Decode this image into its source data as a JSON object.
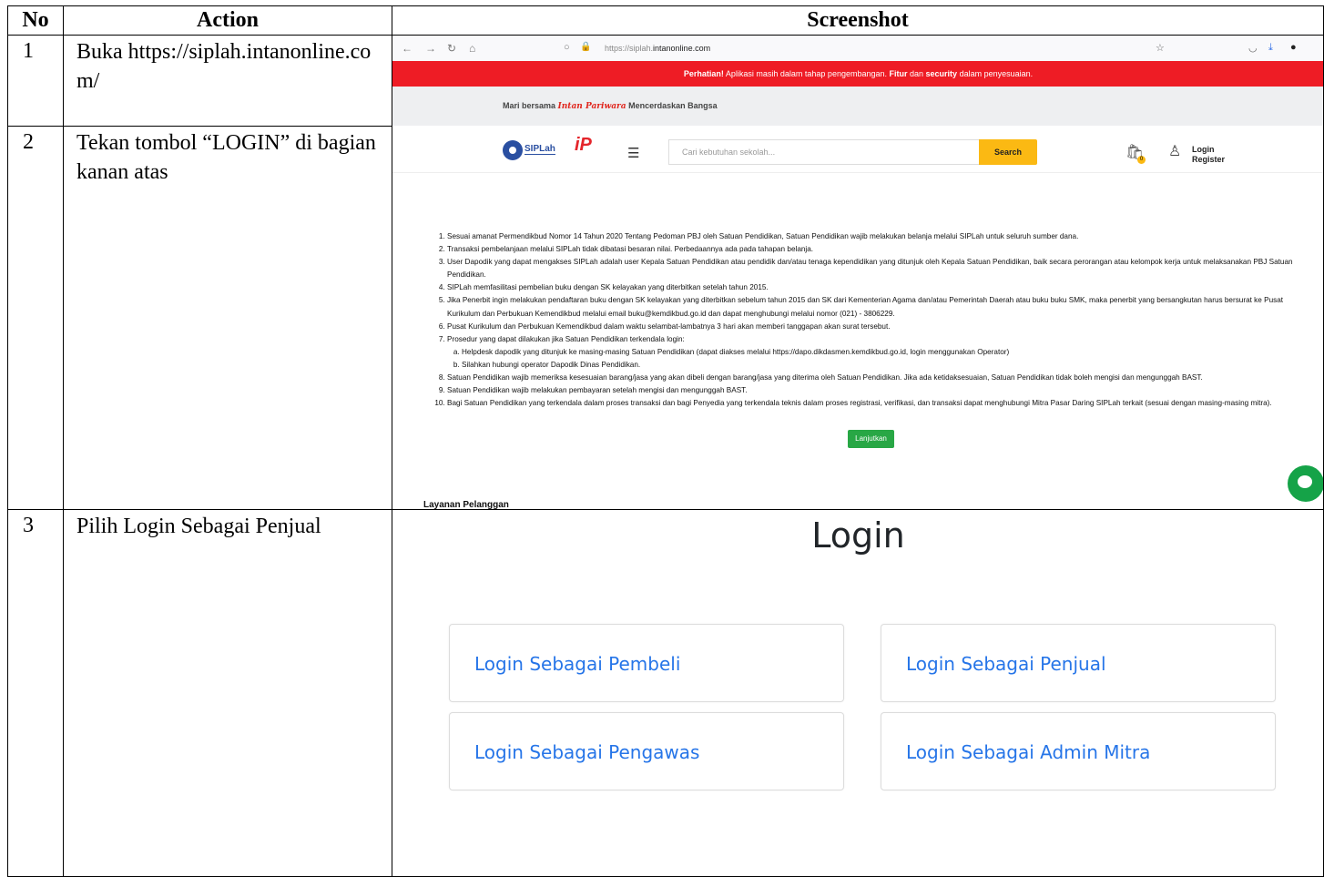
{
  "table": {
    "headers": {
      "no": "No",
      "action": "Action",
      "screenshot": "Screenshot"
    },
    "rows": [
      {
        "no": "1",
        "action": "Buka https://siplah.intanonline.com/"
      },
      {
        "no": "2",
        "action": "Tekan tombol “LOGIN” di bagian kanan atas"
      },
      {
        "no": "3",
        "action": "Pilih Login Sebagai Penjual"
      }
    ]
  },
  "browser": {
    "url_prefix": "https://siplah.",
    "url_domain": "intanonline.com",
    "alert": {
      "bold1": "Perhatian!",
      "text1": " Aplikasi masih dalam tahap pengembangan. ",
      "bold2": "Fitur",
      "text2": " dan ",
      "bold3": "security",
      "text3": " dalam penyesuaian."
    },
    "tagline": {
      "before": "Mari bersama ",
      "brand": "Intan Pariwara",
      "after": " Mencerdaskan Bangsa"
    },
    "logo_text": "SIPLah",
    "logo_ip": "iP",
    "search_placeholder": "Cari kebutuhan sekolah...",
    "search_button": "Search",
    "cart_count": "0",
    "login_label": "Login",
    "register_label": "Register",
    "notice_items": [
      "Sesuai amanat Permendikbud Nomor 14 Tahun 2020 Tentang Pedoman PBJ oleh Satuan Pendidikan, Satuan Pendidikan wajib melakukan belanja melalui SIPLah untuk seluruh sumber dana.",
      "Transaksi pembelanjaan melalui SIPLah tidak dibatasi besaran nilai. Perbedaannya ada pada tahapan belanja.",
      "User Dapodik yang dapat mengakses SIPLah adalah user Kepala Satuan Pendidikan atau pendidik dan/atau tenaga kependidikan yang ditunjuk oleh Kepala Satuan Pendidikan, baik secara perorangan atau kelompok kerja untuk melaksanakan PBJ Satuan Pendidikan.",
      "SIPLah memfasilitasi pembelian buku dengan SK kelayakan yang diterbitkan setelah tahun 2015.",
      "Jika Penerbit ingin melakukan pendaftaran buku dengan SK kelayakan yang diterbitkan sebelum tahun 2015 dan SK dari Kementerian Agama dan/atau Pemerintah Daerah atau buku buku SMK, maka penerbit yang bersangkutan harus bersurat ke Pusat Kurikulum dan Perbukuan Kemendikbud melalui email buku@kemdikbud.go.id dan dapat menghubungi melalui nomor (021) - 3806229.",
      "Pusat Kurikulum dan Perbukuan Kemendikbud dalam waktu selambat-lambatnya 3 hari akan memberi tanggapan akan surat tersebut.",
      "Prosedur yang dapat dilakukan jika Satuan Pendidikan terkendala login:",
      "Satuan Pendidikan wajib memeriksa kesesuaian barang/jasa yang akan dibeli dengan barang/jasa yang diterima oleh Satuan Pendidikan. Jika ada ketidaksesuaian, Satuan Pendidikan tidak boleh mengisi dan mengunggah BAST.",
      "Satuan Pendidikan wajib melakukan pembayaran setelah mengisi dan mengunggah BAST.",
      "Bagi Satuan Pendidikan yang terkendala dalam proses transaksi dan bagi Penyedia yang terkendala teknis dalam proses registrasi, verifikasi, dan transaksi dapat menghubungi Mitra Pasar Daring SIPLah terkait (sesuai dengan masing-masing mitra)."
    ],
    "notice_subitems": [
      "Helpdesk dapodik yang ditunjuk ke masing-masing Satuan Pendidikan (dapat diakses melalui https://dapo.dikdasmen.kemdikbud.go.id, login menggunakan Operator)",
      "Silahkan hubungi operator Dapodik Dinas Pendidikan."
    ],
    "continue_button": "Lanjutkan",
    "footer_label": "Layanan Pelanggan"
  },
  "login": {
    "title": "Login",
    "options": [
      "Login Sebagai Pembeli",
      "Login Sebagai Penjual",
      "Login Sebagai Pengawas",
      "Login Sebagai Admin Mitra"
    ],
    "link_color": "#2675e8"
  },
  "colors": {
    "alert_bar": "#ee1c25",
    "search_button": "#fbb913",
    "continue_button": "#28a745"
  }
}
